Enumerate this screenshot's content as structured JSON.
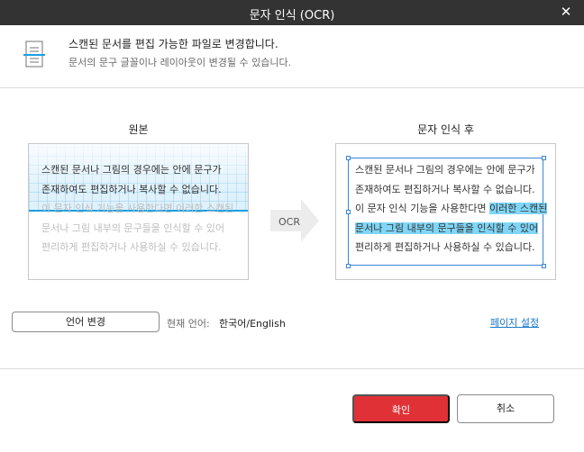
{
  "window": {
    "title": "문자 인식 (OCR)",
    "close_glyph": "✕"
  },
  "header": {
    "icon": "document-scan-icon",
    "title": "스캔된 문서를 편집 가능한 파일로 변경합니다.",
    "subtitle": "문서의 문구 글꼴이나 레이아웃이 변경될 수 있습니다."
  },
  "preview": {
    "original_label": "원본",
    "result_label": "문자 인식 후",
    "arrow_label": "OCR",
    "original_lines": [
      "스캔된 문서나 그림의 경우에는 안에 문구가",
      "존재하여도 편집하거나 복사할 수 없습니다.",
      "이 문자 인식 기능을 사용한다면 이러한 스캔된",
      "문서나 그림 내부의 문구들을 인식할 수 있어",
      "편리하게 편집하거나 사용하실 수 있습니다."
    ],
    "result_lines": {
      "line1": "스캔된 문서나 그림의 경우에는 안에 문구가",
      "line2": "존재하여도 편집하거나 복사할 수 없습니다.",
      "line3_plain": "이 문자 인식 기능을 사용한다면 ",
      "line3_highlight": "이러한 스캔된",
      "line4_highlight": "문서나 그림 내부의 문구들을 인식할 수 있어",
      "line5": "편리하게 편집하거나 사용하실 수 있습니다."
    }
  },
  "language": {
    "button_label": "언어 변경",
    "current_label": "현재 언어:",
    "current_value": "한국어/English",
    "page_settings_link": "페이지 설정"
  },
  "footer": {
    "ok_label": "확인",
    "cancel_label": "취소"
  },
  "colors": {
    "accent": "#e03236",
    "title_bar": "#333333",
    "link": "#1a78c8",
    "highlight": "#7fd6f7",
    "scanline": "#1a9fe0"
  }
}
